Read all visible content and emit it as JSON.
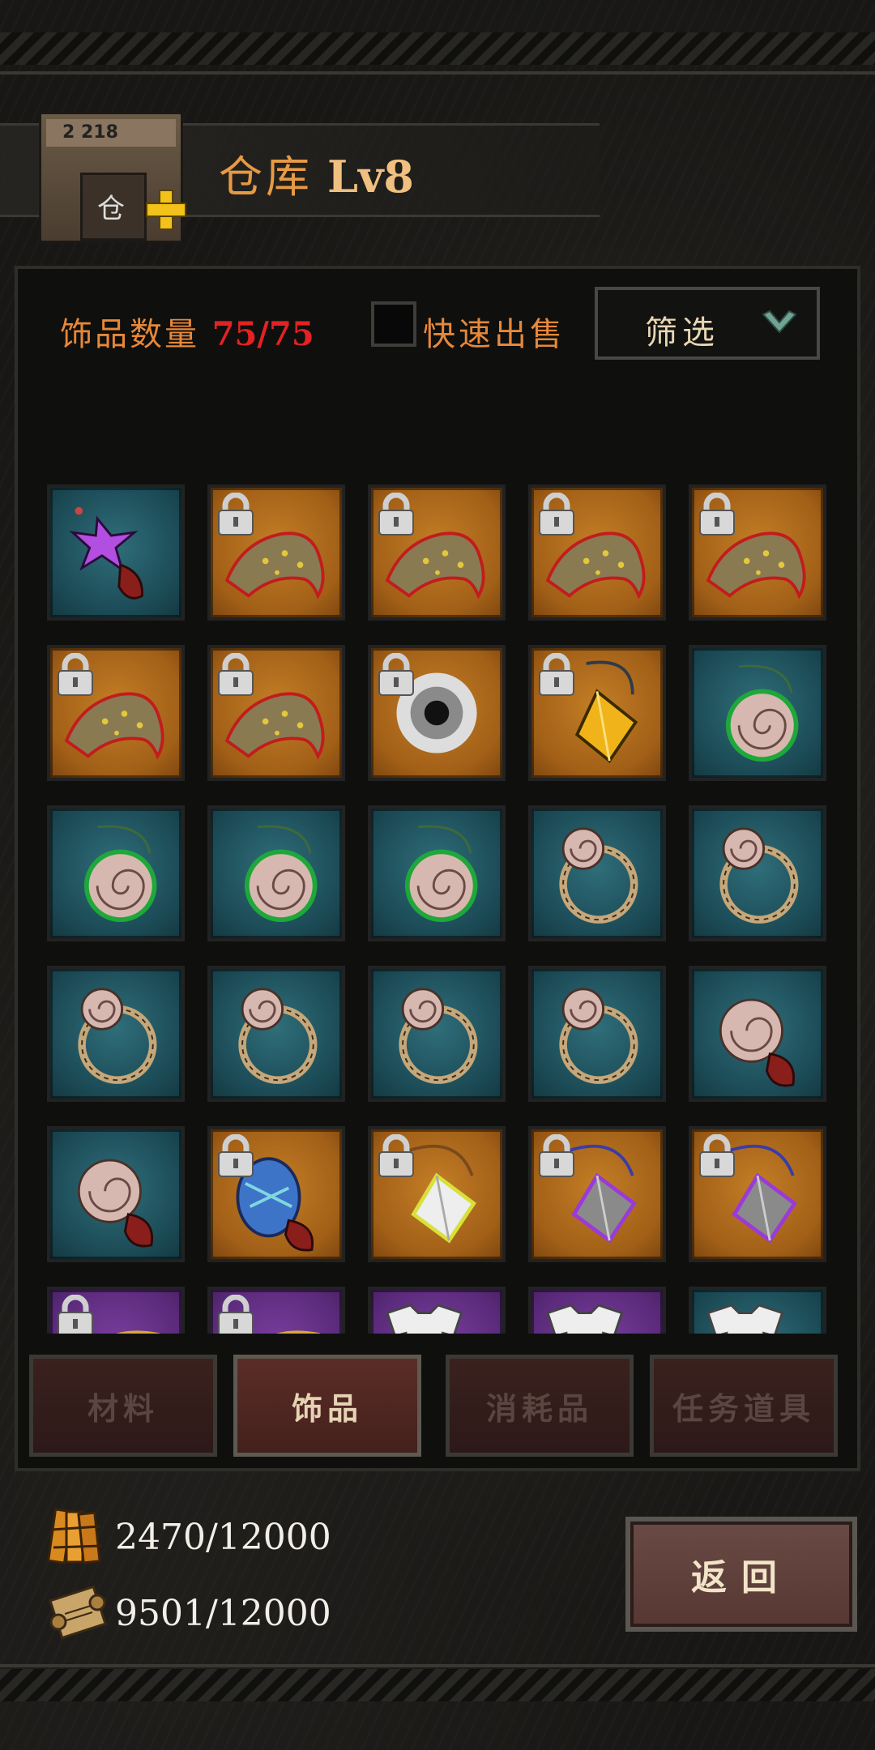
{
  "header": {
    "title": "仓库",
    "level": "Lv8",
    "building_sign": "2 218",
    "building_door": "仓"
  },
  "panel": {
    "count_label": "饰品数量",
    "count_value": "75/75",
    "quick_sell_label": "快速出售",
    "quick_sell_checked": false,
    "filter_label": "筛选"
  },
  "items": [
    {
      "rarity": "teal",
      "locked": false,
      "icon": "purple-star-charm-icon"
    },
    {
      "rarity": "orange",
      "locked": true,
      "icon": "leopard-bone-icon"
    },
    {
      "rarity": "orange",
      "locked": true,
      "icon": "leopard-bone-icon"
    },
    {
      "rarity": "orange",
      "locked": true,
      "icon": "leopard-bone-icon"
    },
    {
      "rarity": "orange",
      "locked": true,
      "icon": "leopard-bone-icon"
    },
    {
      "rarity": "orange",
      "locked": true,
      "icon": "leopard-bone-icon"
    },
    {
      "rarity": "orange",
      "locked": true,
      "icon": "leopard-bone-icon"
    },
    {
      "rarity": "orange",
      "locked": true,
      "icon": "white-vortex-icon"
    },
    {
      "rarity": "orange",
      "locked": true,
      "icon": "yellow-gem-pendant-icon"
    },
    {
      "rarity": "teal",
      "locked": false,
      "icon": "shell-pendant-icon"
    },
    {
      "rarity": "teal",
      "locked": false,
      "icon": "shell-pendant-icon"
    },
    {
      "rarity": "teal",
      "locked": false,
      "icon": "shell-pendant-icon"
    },
    {
      "rarity": "teal",
      "locked": false,
      "icon": "shell-pendant-icon"
    },
    {
      "rarity": "teal",
      "locked": false,
      "icon": "shell-ring-icon"
    },
    {
      "rarity": "teal",
      "locked": false,
      "icon": "shell-ring-icon"
    },
    {
      "rarity": "teal",
      "locked": false,
      "icon": "shell-ring-icon"
    },
    {
      "rarity": "teal",
      "locked": false,
      "icon": "shell-ring-icon"
    },
    {
      "rarity": "teal",
      "locked": false,
      "icon": "shell-ring-icon"
    },
    {
      "rarity": "teal",
      "locked": false,
      "icon": "shell-ring-icon"
    },
    {
      "rarity": "teal",
      "locked": false,
      "icon": "shell-tassel-icon"
    },
    {
      "rarity": "teal",
      "locked": false,
      "icon": "shell-tassel-icon"
    },
    {
      "rarity": "orange",
      "locked": true,
      "icon": "blue-egg-tassel-icon"
    },
    {
      "rarity": "orange",
      "locked": true,
      "icon": "white-gem-pendant-icon"
    },
    {
      "rarity": "orange",
      "locked": true,
      "icon": "gray-gem-pendant-icon"
    },
    {
      "rarity": "orange",
      "locked": true,
      "icon": "gray-gem-pendant-icon"
    },
    {
      "rarity": "purple",
      "locked": true,
      "icon": "bead-necklace-icon"
    },
    {
      "rarity": "purple",
      "locked": true,
      "icon": "bead-necklace-icon"
    },
    {
      "rarity": "purple",
      "locked": false,
      "icon": "shirt-charm-icon"
    },
    {
      "rarity": "purple",
      "locked": false,
      "icon": "shirt-charm-icon"
    },
    {
      "rarity": "teal",
      "locked": false,
      "icon": "shirt-charm-icon"
    }
  ],
  "tabs": [
    {
      "label": "材料",
      "active": false
    },
    {
      "label": "饰品",
      "active": true
    },
    {
      "label": "消耗品",
      "active": false
    },
    {
      "label": "任务道具",
      "active": false
    }
  ],
  "resources": [
    {
      "icon": "wood-plank-icon",
      "value": "2470/12000"
    },
    {
      "icon": "scroll-icon",
      "value": "9501/12000"
    }
  ],
  "back_label": "返回",
  "colors": {
    "teal": "#1b4a55",
    "orange": "#a15f17",
    "purple": "#5a2a7a",
    "label_orange": "#e6883a",
    "count_red": "#e42222"
  }
}
